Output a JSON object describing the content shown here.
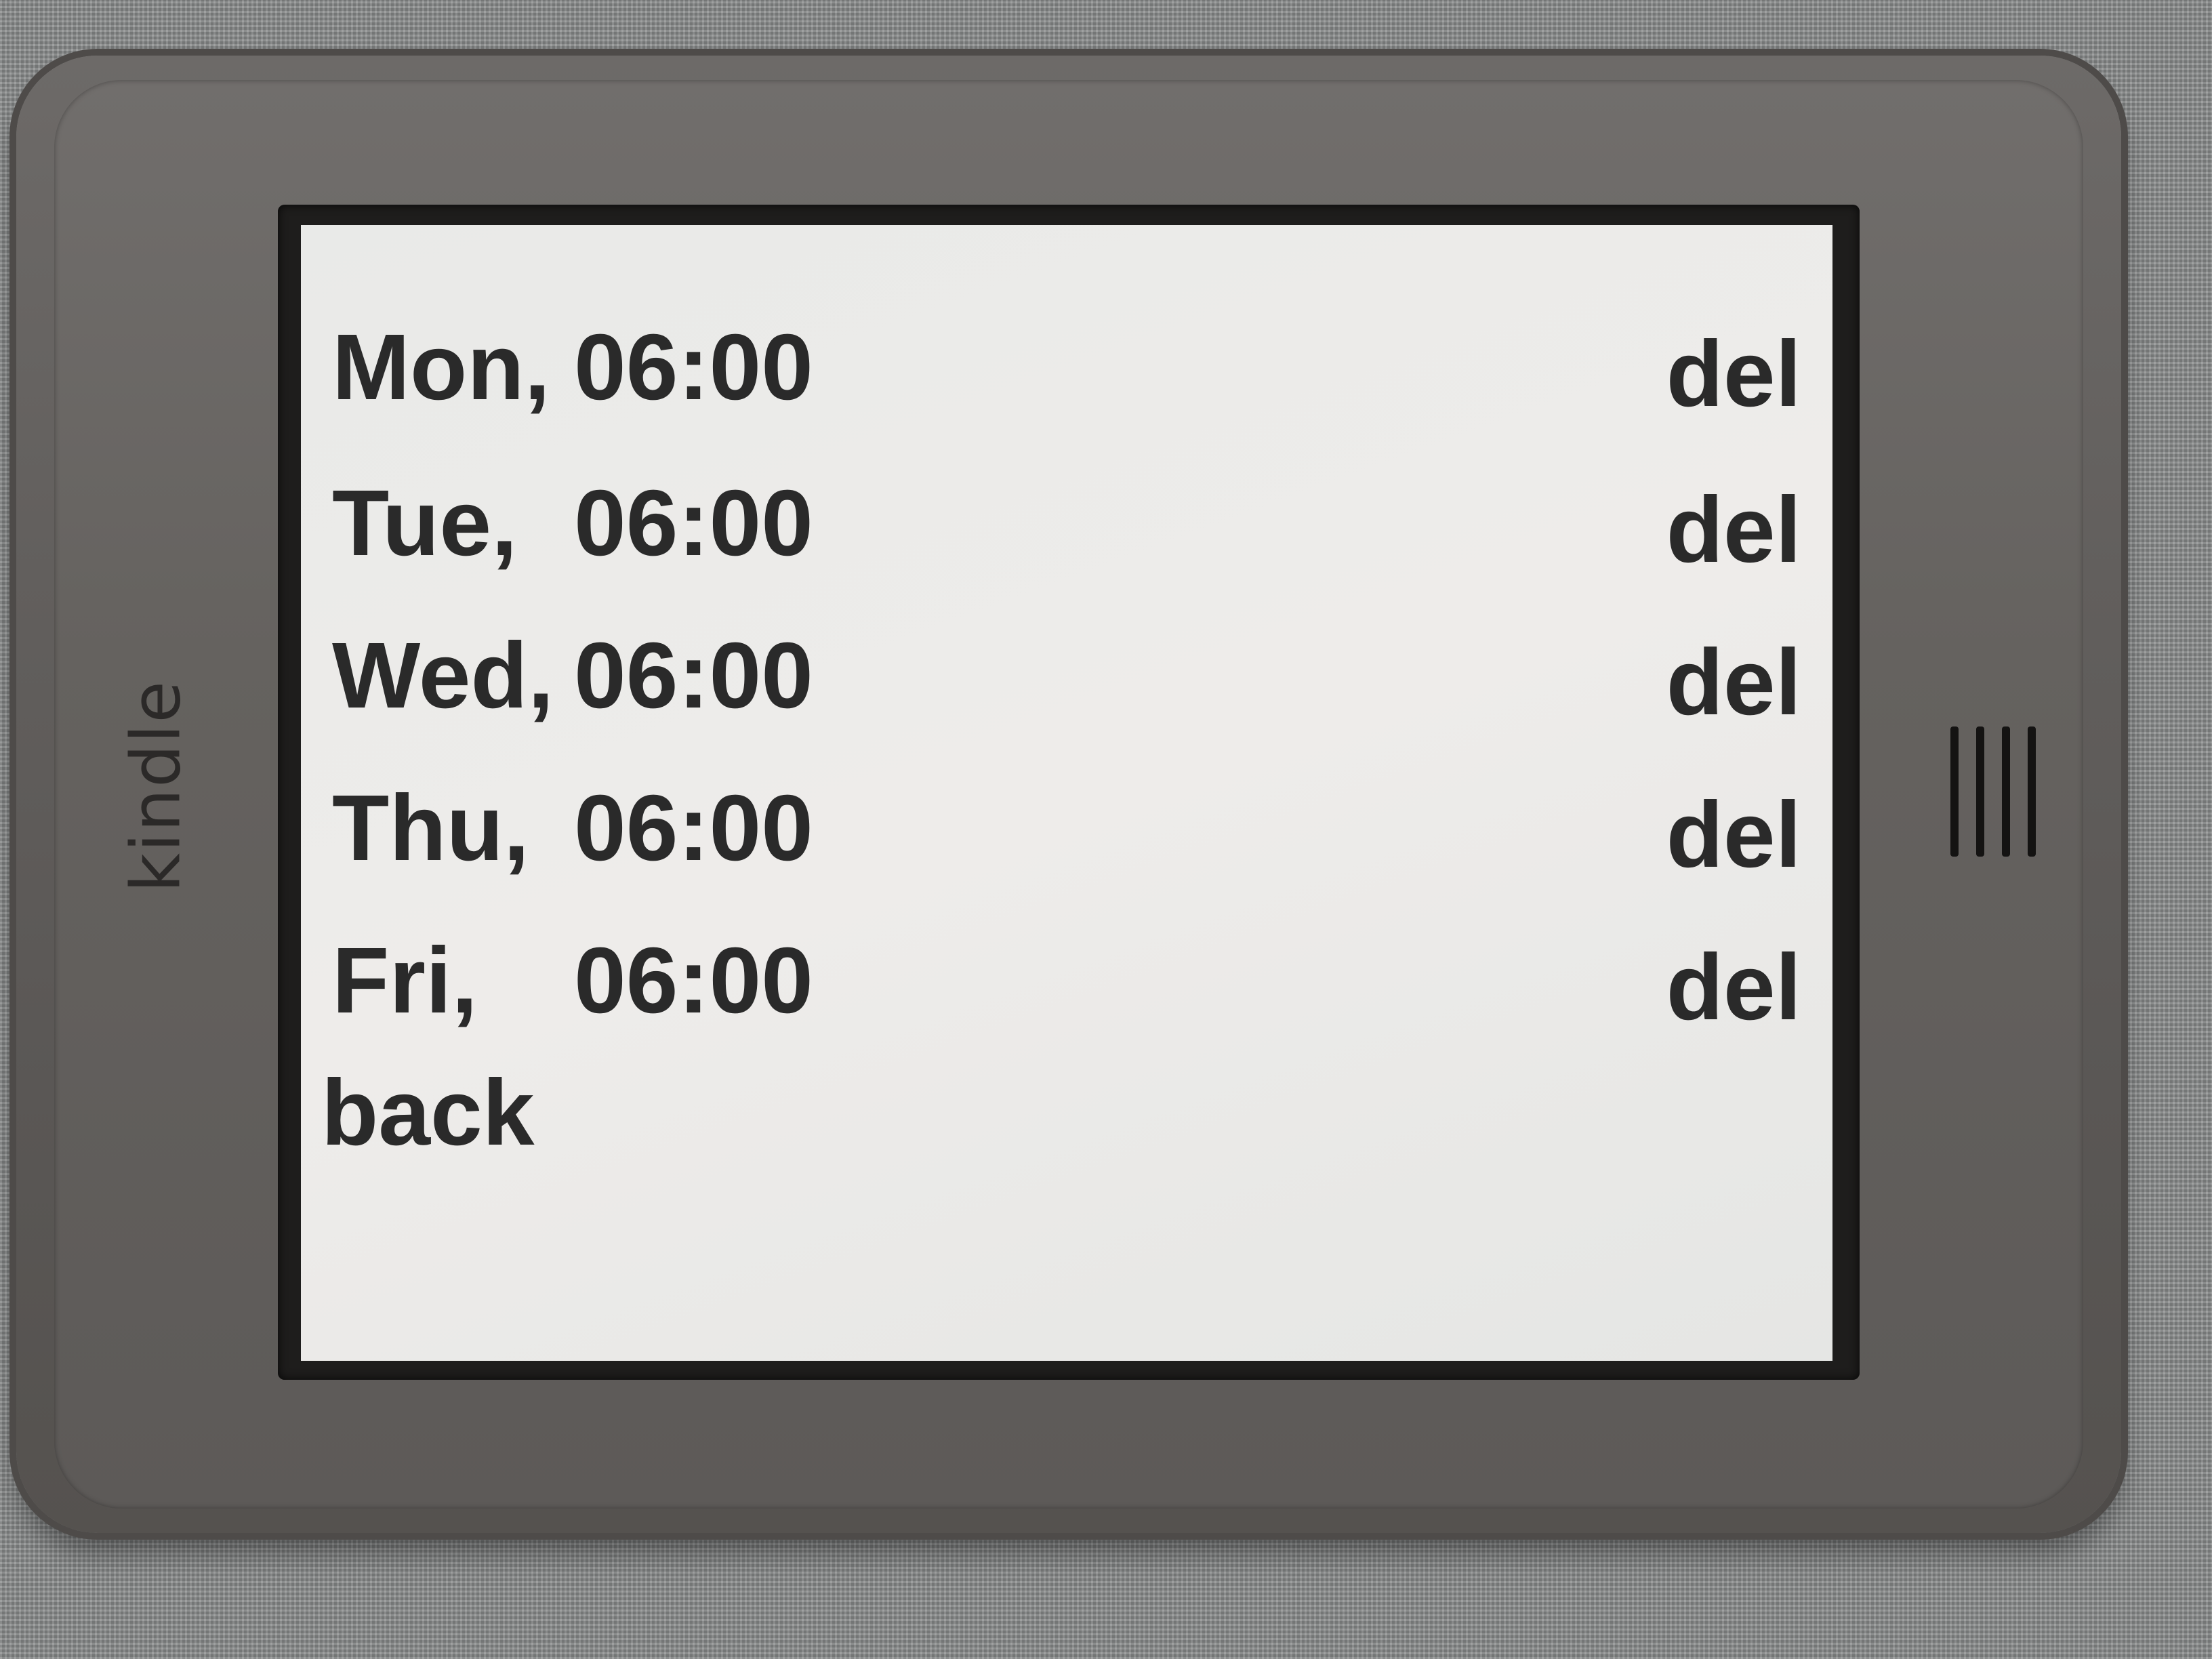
{
  "device": {
    "brand": "kindle"
  },
  "alarms": [
    {
      "day": "Mon,",
      "time": "06:00",
      "delete_label": "del"
    },
    {
      "day": "Tue,",
      "time": "06:00",
      "delete_label": "del"
    },
    {
      "day": "Wed,",
      "time": "06:00",
      "delete_label": "del"
    },
    {
      "day": "Thu,",
      "time": "06:00",
      "delete_label": "del"
    },
    {
      "day": "Fri,",
      "time": "06:00",
      "delete_label": "del"
    }
  ],
  "navigation": {
    "back_label": "back"
  },
  "colors": {
    "screen": "#eceae8",
    "text": "#2a2a2a",
    "bezel": "#65625f",
    "fabric": "#8c8e8e"
  }
}
